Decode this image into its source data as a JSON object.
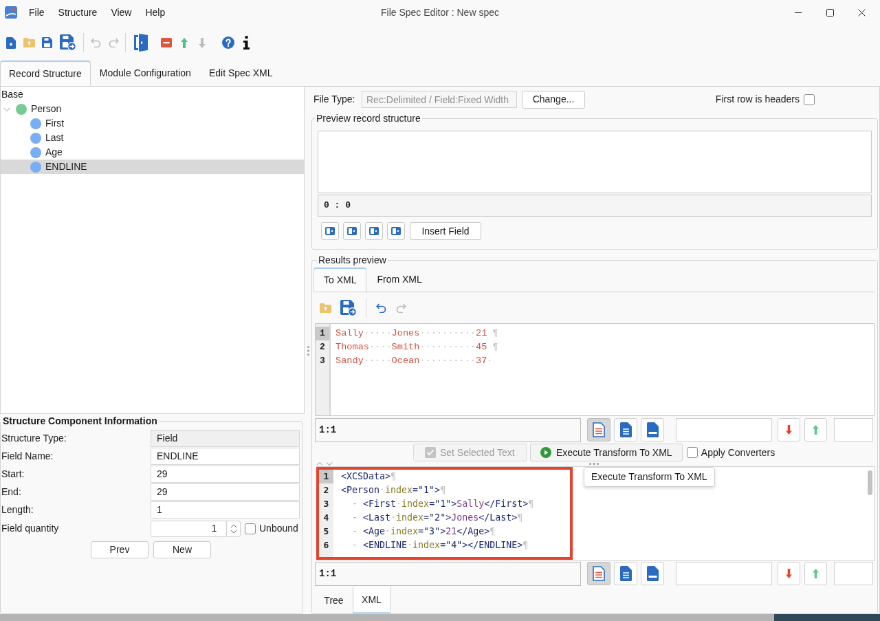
{
  "window": {
    "title": "File Spec Editor : New spec"
  },
  "menu": [
    "File",
    "Structure",
    "View",
    "Help"
  ],
  "toolbar": [
    {
      "kind": "new",
      "disabled": false
    },
    {
      "kind": "open",
      "disabled": false
    },
    {
      "kind": "save",
      "disabled": false
    },
    {
      "kind": "save-as",
      "disabled": false
    },
    {
      "kind": "separator"
    },
    {
      "kind": "undo",
      "disabled": true
    },
    {
      "kind": "redo",
      "disabled": true
    },
    {
      "kind": "separator"
    },
    {
      "kind": "panel",
      "disabled": false
    },
    {
      "kind": "remove",
      "disabled": false
    },
    {
      "kind": "move-up",
      "disabled": false
    },
    {
      "kind": "move-down",
      "disabled": true
    },
    {
      "kind": "help",
      "disabled": false
    },
    {
      "kind": "info",
      "disabled": false
    }
  ],
  "tabs": [
    {
      "label": "Record Structure",
      "selected": true
    },
    {
      "label": "Module Configuration",
      "selected": false
    },
    {
      "label": "Edit Spec XML",
      "selected": false
    }
  ],
  "tree": {
    "root": "Base",
    "items": [
      {
        "label": "Person",
        "kind": "record",
        "expanded": true,
        "selected": false,
        "children": [
          {
            "label": "First",
            "kind": "field",
            "selected": false
          },
          {
            "label": "Last",
            "kind": "field",
            "selected": false
          },
          {
            "label": "Age",
            "kind": "field",
            "selected": false
          },
          {
            "label": "ENDLINE",
            "kind": "field",
            "selected": true
          }
        ]
      }
    ]
  },
  "component_info": {
    "title": "Structure Component Information",
    "fields": [
      {
        "label": "Structure Type:",
        "value": "Field",
        "readonly": true
      },
      {
        "label": "Field Name:",
        "value": "ENDLINE",
        "readonly": false
      },
      {
        "label": "Start:",
        "value": "29",
        "readonly": false
      },
      {
        "label": "End:",
        "value": "29",
        "readonly": false
      },
      {
        "label": "Length:",
        "value": "1",
        "readonly": false
      }
    ],
    "quantity": {
      "label": "Field quantity",
      "value": "1"
    },
    "unbound": {
      "label": "Unbound",
      "checked": false
    },
    "buttons": [
      "Prev",
      "New"
    ]
  },
  "file_type": {
    "label": "File Type:",
    "value": "Rec:Delimited / Field:Fixed Width",
    "disabled": true,
    "button": "Change..."
  },
  "headers_option": {
    "label": "First row is headers",
    "checked": false
  },
  "preview": {
    "title": "Preview record structure",
    "position": "0 : 0",
    "insert_button": "Insert Field"
  },
  "results": {
    "title": "Results preview",
    "tabs": [
      {
        "label": "To XML",
        "selected": true
      },
      {
        "label": "From XML",
        "selected": false
      }
    ],
    "toolbar": [
      {
        "kind": "open",
        "disabled": false
      },
      {
        "kind": "save-as",
        "disabled": false
      },
      {
        "kind": "separator"
      },
      {
        "kind": "undo",
        "disabled": false
      },
      {
        "kind": "redo",
        "disabled": true
      }
    ],
    "input_lines": [
      {
        "number": "1",
        "selected": true,
        "segments": [
          {
            "kind": "text",
            "text": "Sally"
          },
          {
            "kind": "space",
            "text": "·····"
          },
          {
            "kind": "text",
            "text": "Jones"
          },
          {
            "kind": "space",
            "text": "··········"
          },
          {
            "kind": "text",
            "text": "21"
          },
          {
            "kind": "eol",
            "text": " ¶"
          }
        ]
      },
      {
        "number": "2",
        "selected": false,
        "segments": [
          {
            "kind": "text",
            "text": "Thomas"
          },
          {
            "kind": "space",
            "text": "····"
          },
          {
            "kind": "text",
            "text": "Smith"
          },
          {
            "kind": "space",
            "text": "··········"
          },
          {
            "kind": "text",
            "text": "45"
          },
          {
            "kind": "eol",
            "text": " ¶"
          }
        ]
      },
      {
        "number": "3",
        "selected": false,
        "segments": [
          {
            "kind": "text",
            "text": "Sandy"
          },
          {
            "kind": "space",
            "text": "·····"
          },
          {
            "kind": "text",
            "text": "Ocean"
          },
          {
            "kind": "space",
            "text": "··········"
          },
          {
            "kind": "text",
            "text": "37"
          },
          {
            "kind": "space",
            "text": "·"
          }
        ]
      }
    ],
    "input_status": {
      "position": "1:1",
      "view_modes": [
        {
          "kind": "text",
          "selected": true
        },
        {
          "kind": "document",
          "selected": false
        },
        {
          "kind": "html",
          "selected": false
        }
      ]
    },
    "set_selected": {
      "label": "Set Selected Text",
      "disabled": true
    },
    "execute": {
      "label": "Execute Transform To XML"
    },
    "apply_converters": {
      "label": "Apply Converters",
      "checked": false
    },
    "output_lines": [
      {
        "number": "1",
        "selected": true,
        "segments": [
          {
            "kind": "tag",
            "text": "<XCSData>"
          },
          {
            "kind": "eol",
            "text": "¶"
          }
        ]
      },
      {
        "number": "2",
        "selected": false,
        "segments": [
          {
            "kind": "tag",
            "text": "<Person"
          },
          {
            "kind": "space",
            "text": "·"
          },
          {
            "kind": "attr",
            "text": "index"
          },
          {
            "kind": "tag",
            "text": "=\"1\">"
          },
          {
            "kind": "eol",
            "text": "¶"
          }
        ]
      },
      {
        "number": "3",
        "selected": false,
        "segments": [
          {
            "kind": "guide",
            "text": "  - "
          },
          {
            "kind": "tag",
            "text": "<First"
          },
          {
            "kind": "space",
            "text": "·"
          },
          {
            "kind": "attr",
            "text": "index"
          },
          {
            "kind": "tag",
            "text": "=\"1\">"
          },
          {
            "kind": "content",
            "text": "Sally"
          },
          {
            "kind": "tag",
            "text": "</First>"
          },
          {
            "kind": "eol",
            "text": "¶"
          }
        ]
      },
      {
        "number": "4",
        "selected": false,
        "segments": [
          {
            "kind": "guide",
            "text": "  - "
          },
          {
            "kind": "tag",
            "text": "<Last"
          },
          {
            "kind": "space",
            "text": "·"
          },
          {
            "kind": "attr",
            "text": "index"
          },
          {
            "kind": "tag",
            "text": "=\"2\">"
          },
          {
            "kind": "content",
            "text": "Jones"
          },
          {
            "kind": "tag",
            "text": "</Last>"
          },
          {
            "kind": "eol",
            "text": "¶"
          }
        ]
      },
      {
        "number": "5",
        "selected": false,
        "segments": [
          {
            "kind": "guide",
            "text": "  - "
          },
          {
            "kind": "tag",
            "text": "<Age"
          },
          {
            "kind": "space",
            "text": "·"
          },
          {
            "kind": "attr",
            "text": "index"
          },
          {
            "kind": "tag",
            "text": "=\"3\">"
          },
          {
            "kind": "content",
            "text": "21"
          },
          {
            "kind": "tag",
            "text": "</Age>"
          },
          {
            "kind": "eol",
            "text": "¶"
          }
        ]
      },
      {
        "number": "6",
        "selected": false,
        "segments": [
          {
            "kind": "guide",
            "text": "  - "
          },
          {
            "kind": "tag",
            "text": "<ENDLINE"
          },
          {
            "kind": "space",
            "text": "·"
          },
          {
            "kind": "attr",
            "text": "index"
          },
          {
            "kind": "tag",
            "text": "=\"4\"></ENDLINE>"
          },
          {
            "kind": "eol",
            "text": "¶"
          }
        ]
      }
    ],
    "tooltip": "Execute Transform To XML",
    "output_status": {
      "position": "1:1",
      "view_modes": [
        {
          "kind": "text",
          "selected": true
        },
        {
          "kind": "document",
          "selected": false
        },
        {
          "kind": "html",
          "selected": false
        }
      ]
    },
    "bottom_tabs": [
      {
        "label": "Tree",
        "selected": false
      },
      {
        "label": "XML",
        "selected": true
      }
    ]
  }
}
